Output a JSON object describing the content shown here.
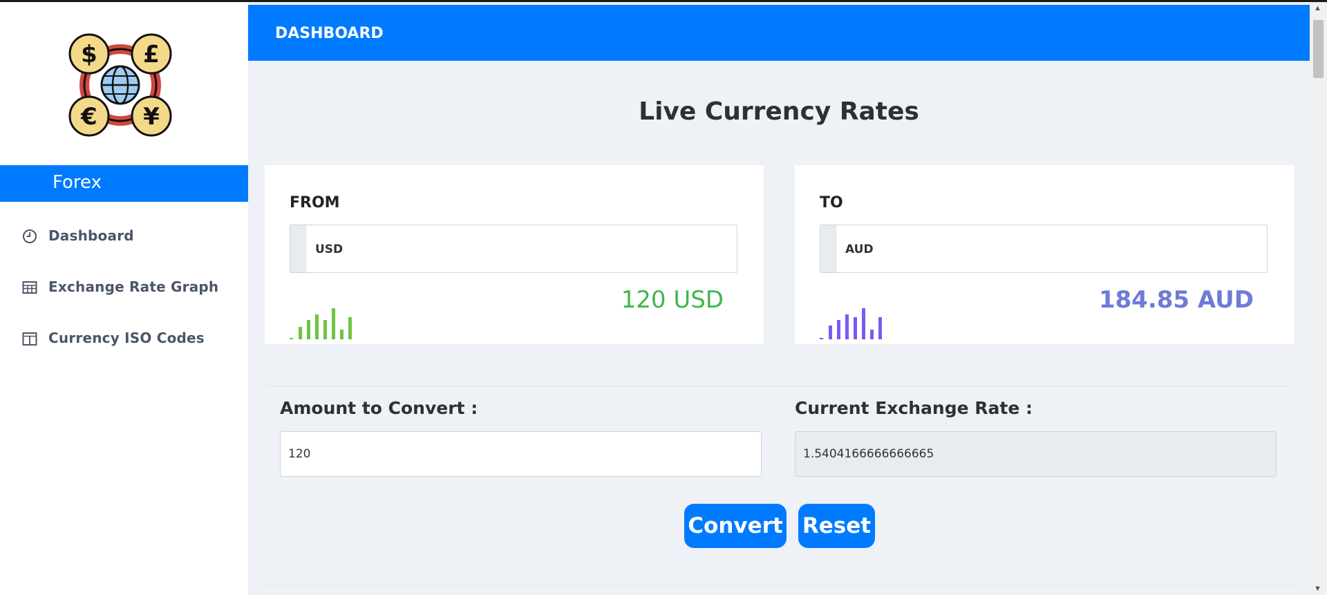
{
  "sidebar": {
    "brand": "Forex",
    "logo_icon": "currency-exchange-logo-icon",
    "items": [
      {
        "label": "Dashboard",
        "icon": "clock-icon"
      },
      {
        "label": "Exchange Rate Graph",
        "icon": "table-icon"
      },
      {
        "label": "Currency ISO Codes",
        "icon": "columns-icon"
      }
    ]
  },
  "header": {
    "title": "DASHBOARD"
  },
  "main": {
    "title": "Live Currency Rates",
    "from_card": {
      "label": "FROM",
      "selected": "USD",
      "amount": "120 USD",
      "bar_color": "#6cc644"
    },
    "to_card": {
      "label": "TO",
      "selected": "AUD",
      "amount": "184.85 AUD",
      "bar_color": "#7a5af0"
    },
    "amount_field": {
      "label": "Amount to Convert :",
      "value": "120"
    },
    "rate_field": {
      "label": "Current Exchange Rate :",
      "value": "1.5404166666666665"
    },
    "buttons": {
      "convert": "Convert",
      "reset": "Reset"
    }
  },
  "colors": {
    "accent": "#007bff",
    "from_amount": "#3db84a",
    "to_amount": "#6f7bd8"
  }
}
